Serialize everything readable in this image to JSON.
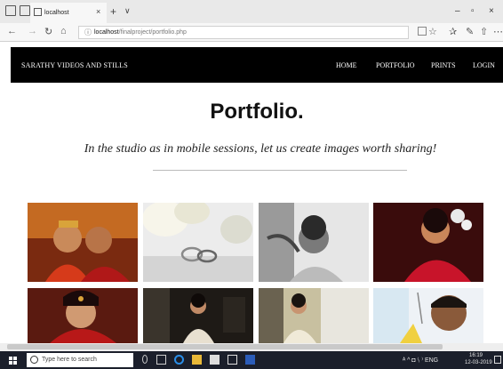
{
  "browser": {
    "tab_title": "localhost",
    "tab_close": "×",
    "new_tab": "+",
    "tab_menu": "∨",
    "minimize": "–",
    "maximize": "▫",
    "close": "×",
    "back": "←",
    "forward": "→",
    "refresh": "↻",
    "home": "⌂",
    "info": "ⓘ",
    "url_host": "localhost",
    "url_path": "/finalproject/portfolio.php",
    "favorite": "☆",
    "favorites_bar": "✰",
    "notes": "✎",
    "share": "⇧",
    "more": "⋯"
  },
  "site": {
    "brand": "SARATHY VIDEOS AND STILLS",
    "nav": [
      "HOME",
      "PORTFOLIO",
      "PRINTS",
      "LOGIN"
    ]
  },
  "page": {
    "title": "Portfolio.",
    "tagline": "In the studio as in mobile sessions, let us create images worth sharing!"
  },
  "gallery": {
    "photos": [
      {
        "subject": "bride-groom-portrait"
      },
      {
        "subject": "wedding-rings-flowers"
      },
      {
        "subject": "bride-monochrome"
      },
      {
        "subject": "bride-red-saree"
      },
      {
        "subject": "bride-portrait-red"
      },
      {
        "subject": "bride-window"
      },
      {
        "subject": "bride-soft-light"
      },
      {
        "subject": "groom-smiling"
      }
    ]
  },
  "taskbar": {
    "search_placeholder": "Type here to search",
    "tray": "ᴬ ^ ◘ ⁽ᵢ ⁾ ENG",
    "time": "16:19",
    "date": "12-03-2019"
  },
  "colors": {
    "nav_background": "#000000",
    "taskbar_background": "#1b1f2b"
  }
}
